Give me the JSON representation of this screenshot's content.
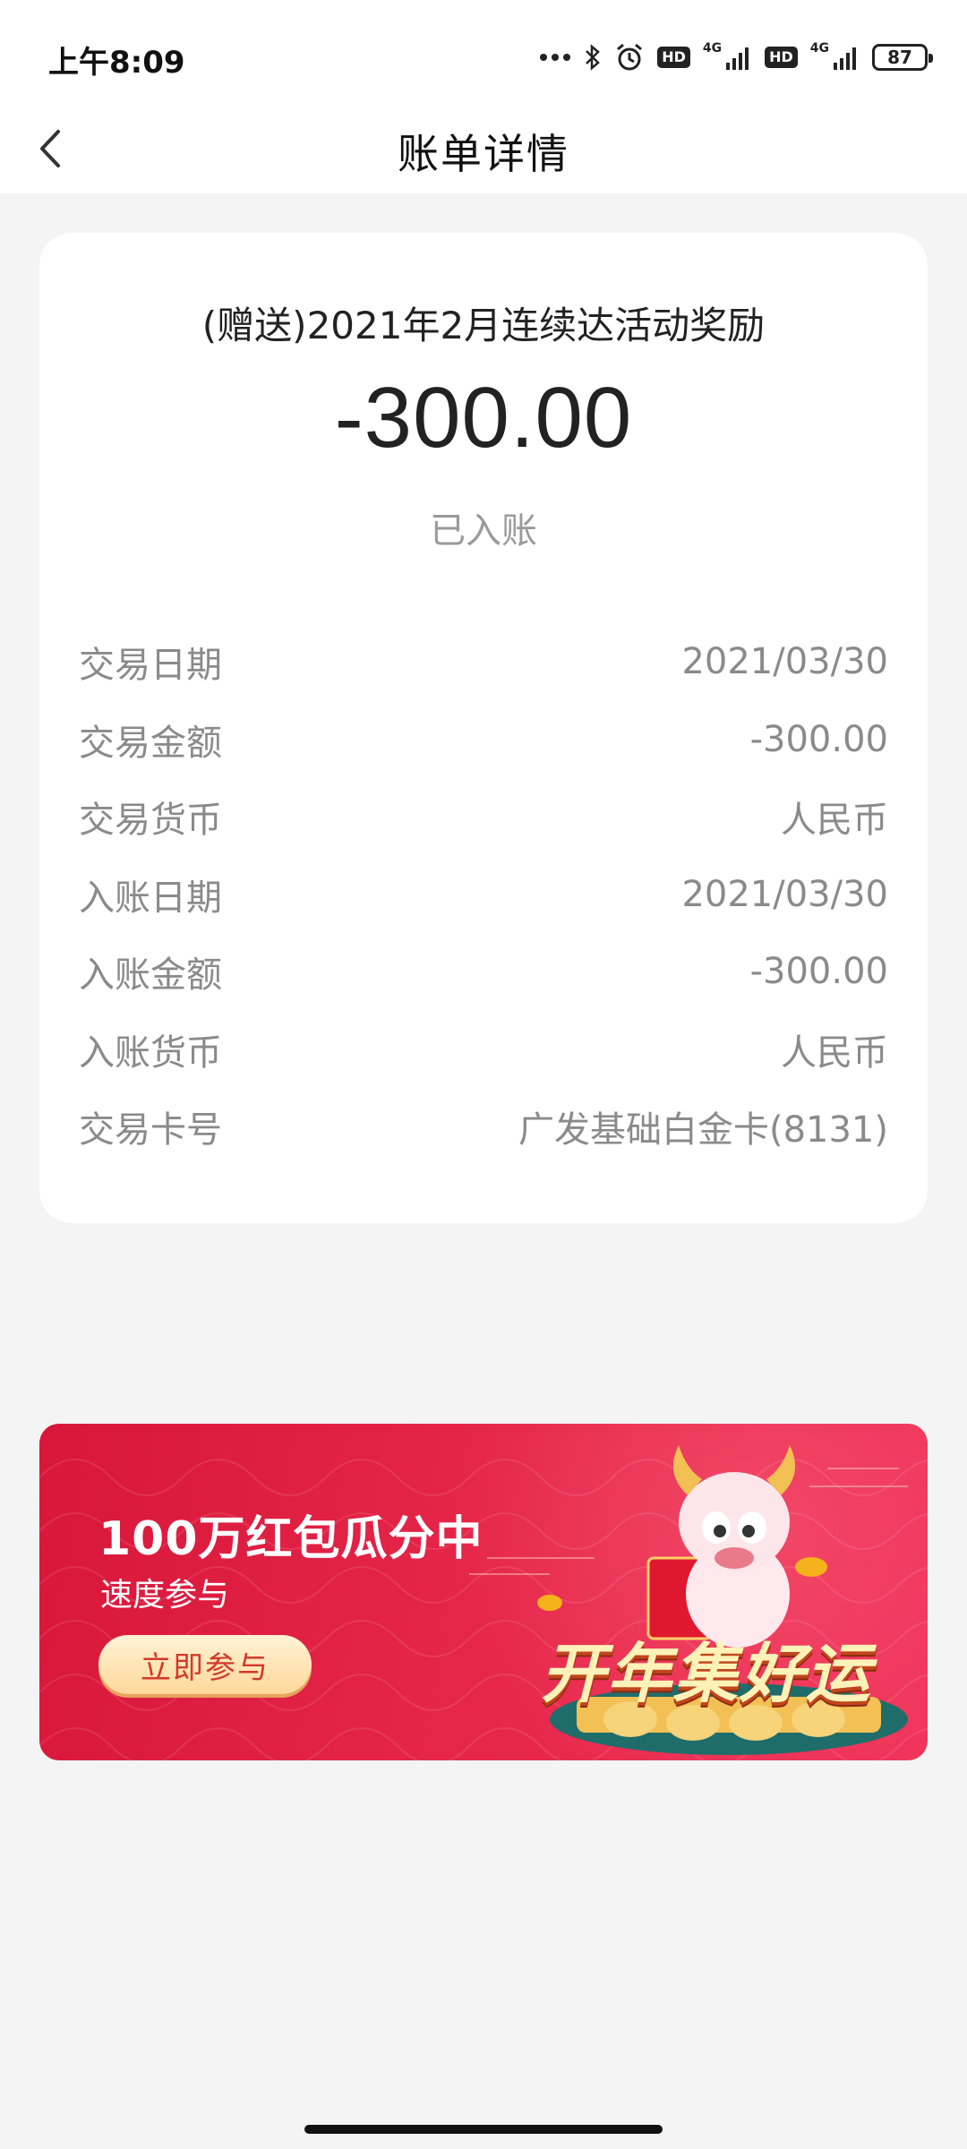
{
  "status_bar": {
    "time": "上午8:09",
    "network1": "4G",
    "network2": "4G",
    "hd1": "HD",
    "hd2": "HD",
    "battery": "87"
  },
  "header": {
    "title": "账单详情",
    "back_icon": "chevron-left-icon"
  },
  "transaction": {
    "title": "(赠送)2021年2月连续达活动奖励",
    "amount": "-300.00",
    "status": "已入账",
    "details": [
      {
        "label": "交易日期",
        "value": "2021/03/30"
      },
      {
        "label": "交易金额",
        "value": "-300.00"
      },
      {
        "label": "交易货币",
        "value": "人民币"
      },
      {
        "label": "入账日期",
        "value": "2021/03/30"
      },
      {
        "label": "入账金额",
        "value": "-300.00"
      },
      {
        "label": "入账货币",
        "value": "人民币"
      },
      {
        "label": "交易卡号",
        "value": "广发基础白金卡(8131)"
      }
    ]
  },
  "promo": {
    "headline": "100万红包瓜分中",
    "subtitle": "速度参与",
    "cta_label": "立即参与",
    "slogan": "开年集好运",
    "colors": {
      "primary": "#e42548",
      "cta": "#ffd89a"
    }
  }
}
